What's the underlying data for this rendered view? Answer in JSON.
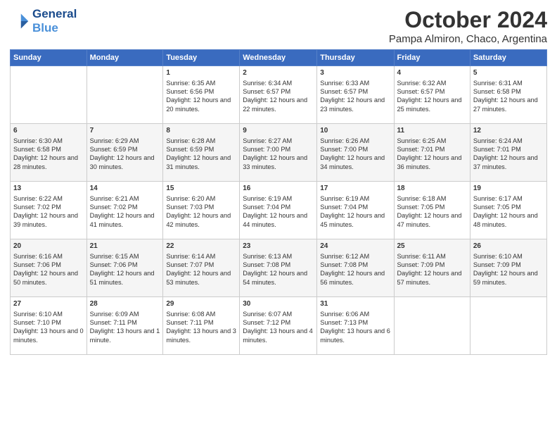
{
  "logo": {
    "line1": "General",
    "line2": "Blue"
  },
  "title": "October 2024",
  "subtitle": "Pampa Almiron, Chaco, Argentina",
  "headers": [
    "Sunday",
    "Monday",
    "Tuesday",
    "Wednesday",
    "Thursday",
    "Friday",
    "Saturday"
  ],
  "weeks": [
    [
      {
        "day": "",
        "info": ""
      },
      {
        "day": "",
        "info": ""
      },
      {
        "day": "1",
        "info": "Sunrise: 6:35 AM\nSunset: 6:56 PM\nDaylight: 12 hours and 20 minutes."
      },
      {
        "day": "2",
        "info": "Sunrise: 6:34 AM\nSunset: 6:57 PM\nDaylight: 12 hours and 22 minutes."
      },
      {
        "day": "3",
        "info": "Sunrise: 6:33 AM\nSunset: 6:57 PM\nDaylight: 12 hours and 23 minutes."
      },
      {
        "day": "4",
        "info": "Sunrise: 6:32 AM\nSunset: 6:57 PM\nDaylight: 12 hours and 25 minutes."
      },
      {
        "day": "5",
        "info": "Sunrise: 6:31 AM\nSunset: 6:58 PM\nDaylight: 12 hours and 27 minutes."
      }
    ],
    [
      {
        "day": "6",
        "info": "Sunrise: 6:30 AM\nSunset: 6:58 PM\nDaylight: 12 hours and 28 minutes."
      },
      {
        "day": "7",
        "info": "Sunrise: 6:29 AM\nSunset: 6:59 PM\nDaylight: 12 hours and 30 minutes."
      },
      {
        "day": "8",
        "info": "Sunrise: 6:28 AM\nSunset: 6:59 PM\nDaylight: 12 hours and 31 minutes."
      },
      {
        "day": "9",
        "info": "Sunrise: 6:27 AM\nSunset: 7:00 PM\nDaylight: 12 hours and 33 minutes."
      },
      {
        "day": "10",
        "info": "Sunrise: 6:26 AM\nSunset: 7:00 PM\nDaylight: 12 hours and 34 minutes."
      },
      {
        "day": "11",
        "info": "Sunrise: 6:25 AM\nSunset: 7:01 PM\nDaylight: 12 hours and 36 minutes."
      },
      {
        "day": "12",
        "info": "Sunrise: 6:24 AM\nSunset: 7:01 PM\nDaylight: 12 hours and 37 minutes."
      }
    ],
    [
      {
        "day": "13",
        "info": "Sunrise: 6:22 AM\nSunset: 7:02 PM\nDaylight: 12 hours and 39 minutes."
      },
      {
        "day": "14",
        "info": "Sunrise: 6:21 AM\nSunset: 7:02 PM\nDaylight: 12 hours and 41 minutes."
      },
      {
        "day": "15",
        "info": "Sunrise: 6:20 AM\nSunset: 7:03 PM\nDaylight: 12 hours and 42 minutes."
      },
      {
        "day": "16",
        "info": "Sunrise: 6:19 AM\nSunset: 7:04 PM\nDaylight: 12 hours and 44 minutes."
      },
      {
        "day": "17",
        "info": "Sunrise: 6:19 AM\nSunset: 7:04 PM\nDaylight: 12 hours and 45 minutes."
      },
      {
        "day": "18",
        "info": "Sunrise: 6:18 AM\nSunset: 7:05 PM\nDaylight: 12 hours and 47 minutes."
      },
      {
        "day": "19",
        "info": "Sunrise: 6:17 AM\nSunset: 7:05 PM\nDaylight: 12 hours and 48 minutes."
      }
    ],
    [
      {
        "day": "20",
        "info": "Sunrise: 6:16 AM\nSunset: 7:06 PM\nDaylight: 12 hours and 50 minutes."
      },
      {
        "day": "21",
        "info": "Sunrise: 6:15 AM\nSunset: 7:06 PM\nDaylight: 12 hours and 51 minutes."
      },
      {
        "day": "22",
        "info": "Sunrise: 6:14 AM\nSunset: 7:07 PM\nDaylight: 12 hours and 53 minutes."
      },
      {
        "day": "23",
        "info": "Sunrise: 6:13 AM\nSunset: 7:08 PM\nDaylight: 12 hours and 54 minutes."
      },
      {
        "day": "24",
        "info": "Sunrise: 6:12 AM\nSunset: 7:08 PM\nDaylight: 12 hours and 56 minutes."
      },
      {
        "day": "25",
        "info": "Sunrise: 6:11 AM\nSunset: 7:09 PM\nDaylight: 12 hours and 57 minutes."
      },
      {
        "day": "26",
        "info": "Sunrise: 6:10 AM\nSunset: 7:09 PM\nDaylight: 12 hours and 59 minutes."
      }
    ],
    [
      {
        "day": "27",
        "info": "Sunrise: 6:10 AM\nSunset: 7:10 PM\nDaylight: 13 hours and 0 minutes."
      },
      {
        "day": "28",
        "info": "Sunrise: 6:09 AM\nSunset: 7:11 PM\nDaylight: 13 hours and 1 minute."
      },
      {
        "day": "29",
        "info": "Sunrise: 6:08 AM\nSunset: 7:11 PM\nDaylight: 13 hours and 3 minutes."
      },
      {
        "day": "30",
        "info": "Sunrise: 6:07 AM\nSunset: 7:12 PM\nDaylight: 13 hours and 4 minutes."
      },
      {
        "day": "31",
        "info": "Sunrise: 6:06 AM\nSunset: 7:13 PM\nDaylight: 13 hours and 6 minutes."
      },
      {
        "day": "",
        "info": ""
      },
      {
        "day": "",
        "info": ""
      }
    ]
  ]
}
